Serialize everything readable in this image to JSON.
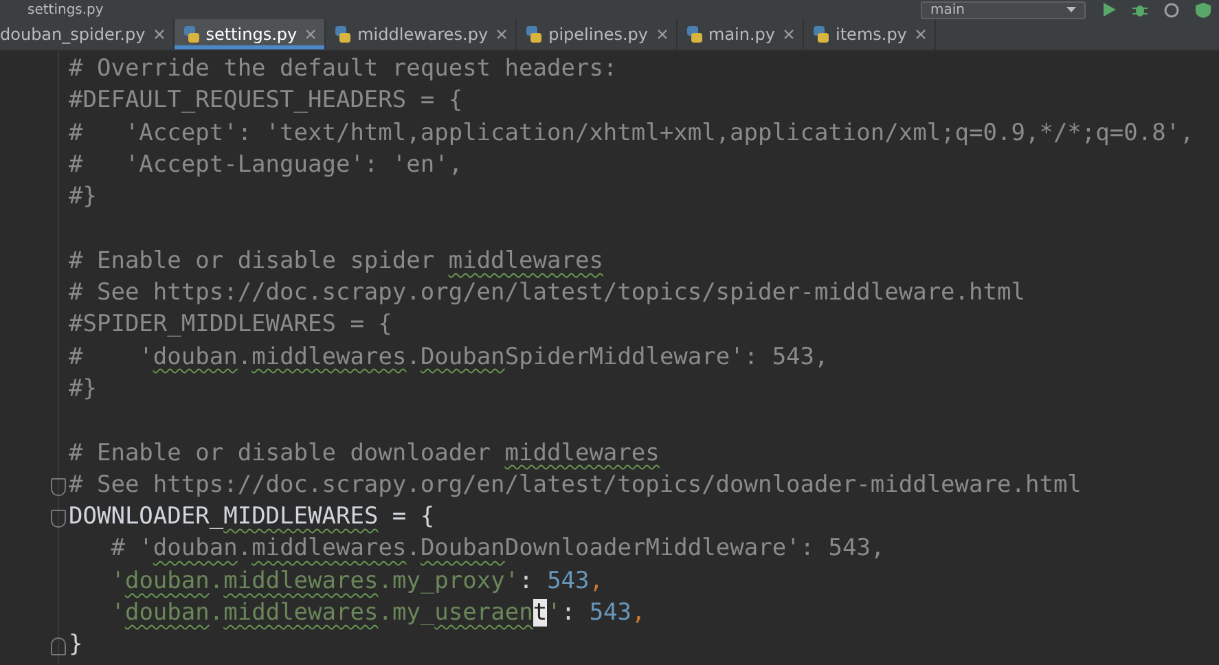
{
  "window": {
    "title": "settings.py"
  },
  "run_config": {
    "label": "main"
  },
  "tabs": [
    {
      "label": "douban_spider.py",
      "selected": false
    },
    {
      "label": "settings.py",
      "selected": true
    },
    {
      "label": "middlewares.py",
      "selected": false
    },
    {
      "label": "pipelines.py",
      "selected": false
    },
    {
      "label": "main.py",
      "selected": false
    },
    {
      "label": "items.py",
      "selected": false
    }
  ],
  "editor": {
    "blocks": [
      {
        "lines": [
          {
            "tokens": [
              {
                "kind": "comment",
                "text": "# Override the default request headers:"
              }
            ]
          },
          {
            "tokens": [
              {
                "kind": "comment",
                "text": "#DEFAULT_REQUEST_HEADERS = {"
              }
            ]
          },
          {
            "tokens": [
              {
                "kind": "comment",
                "text": "#   'Accept': 'text/html,application/xhtml+xml,application/xml;q=0.9,*/*;q=0.8',"
              }
            ]
          },
          {
            "tokens": [
              {
                "kind": "comment",
                "text": "#   'Accept-Language': 'en',"
              }
            ]
          },
          {
            "tokens": [
              {
                "kind": "comment",
                "text": "#}"
              }
            ]
          }
        ]
      },
      {
        "lines": [
          {
            "tokens": [
              {
                "kind": "comment",
                "text": "# Enable or disable spider "
              },
              {
                "kind": "comment",
                "text": "middlewares",
                "typo": true
              }
            ]
          },
          {
            "tokens": [
              {
                "kind": "comment",
                "text": "# See https://doc.scrapy.org/en/latest/topics/spider-middleware.html"
              }
            ]
          },
          {
            "tokens": [
              {
                "kind": "comment",
                "text": "#SPIDER_MIDDLEWARES = {"
              }
            ]
          },
          {
            "tokens": [
              {
                "kind": "comment",
                "text": "#    '"
              },
              {
                "kind": "comment",
                "text": "douban",
                "typo": true
              },
              {
                "kind": "comment",
                "text": "."
              },
              {
                "kind": "comment",
                "text": "middlewares",
                "typo": true
              },
              {
                "kind": "comment",
                "text": "."
              },
              {
                "kind": "comment",
                "text": "Douban",
                "typo": true
              },
              {
                "kind": "comment",
                "text": "SpiderMiddleware': 543,"
              }
            ]
          },
          {
            "tokens": [
              {
                "kind": "comment",
                "text": "#}"
              }
            ]
          }
        ]
      },
      {
        "lines": [
          {
            "tokens": [
              {
                "kind": "comment",
                "text": "# Enable or disable downloader "
              },
              {
                "kind": "comment",
                "text": "middlewares",
                "typo": true
              }
            ]
          },
          {
            "fold_open": true,
            "tokens": [
              {
                "kind": "comment",
                "text": "# See https://doc.scrapy.org/en/latest/topics/downloader-middleware.html"
              }
            ]
          },
          {
            "fold_open": true,
            "tokens": [
              {
                "kind": "code",
                "text": "DOWNLOADER_"
              },
              {
                "kind": "code",
                "text": "MIDDLEWARES",
                "typo": true
              },
              {
                "kind": "code",
                "text": " = {"
              }
            ]
          },
          {
            "tokens": [
              {
                "kind": "comment",
                "text": "   # '"
              },
              {
                "kind": "comment",
                "text": "douban",
                "typo": true
              },
              {
                "kind": "comment",
                "text": "."
              },
              {
                "kind": "comment",
                "text": "middlewares",
                "typo": true
              },
              {
                "kind": "comment",
                "text": "."
              },
              {
                "kind": "comment",
                "text": "Douban",
                "typo": true
              },
              {
                "kind": "comment",
                "text": "DownloaderMiddleware': 543,"
              }
            ]
          },
          {
            "tokens": [
              {
                "kind": "string",
                "text": "   '"
              },
              {
                "kind": "string",
                "text": "douban",
                "typo": true
              },
              {
                "kind": "string",
                "text": "."
              },
              {
                "kind": "string",
                "text": "middlewares",
                "typo": true
              },
              {
                "kind": "string",
                "text": ".my_proxy'"
              },
              {
                "kind": "code",
                "text": ": "
              },
              {
                "kind": "number",
                "text": "543"
              },
              {
                "kind": "punct",
                "text": ","
              }
            ]
          },
          {
            "tokens": [
              {
                "kind": "string",
                "text": "   '"
              },
              {
                "kind": "string",
                "text": "douban",
                "typo": true
              },
              {
                "kind": "string",
                "text": "."
              },
              {
                "kind": "string",
                "text": "middlewares",
                "typo": true
              },
              {
                "kind": "string",
                "text": ".my_"
              },
              {
                "kind": "string",
                "text": "useraen",
                "typo": true
              },
              {
                "kind": "string",
                "text": "t",
                "caret": true
              },
              {
                "kind": "string",
                "text": "'"
              },
              {
                "kind": "code",
                "text": ": "
              },
              {
                "kind": "number",
                "text": "543"
              },
              {
                "kind": "punct",
                "text": ","
              }
            ]
          },
          {
            "fold_close": true,
            "tokens": [
              {
                "kind": "code",
                "text": "}"
              }
            ]
          }
        ]
      }
    ]
  }
}
